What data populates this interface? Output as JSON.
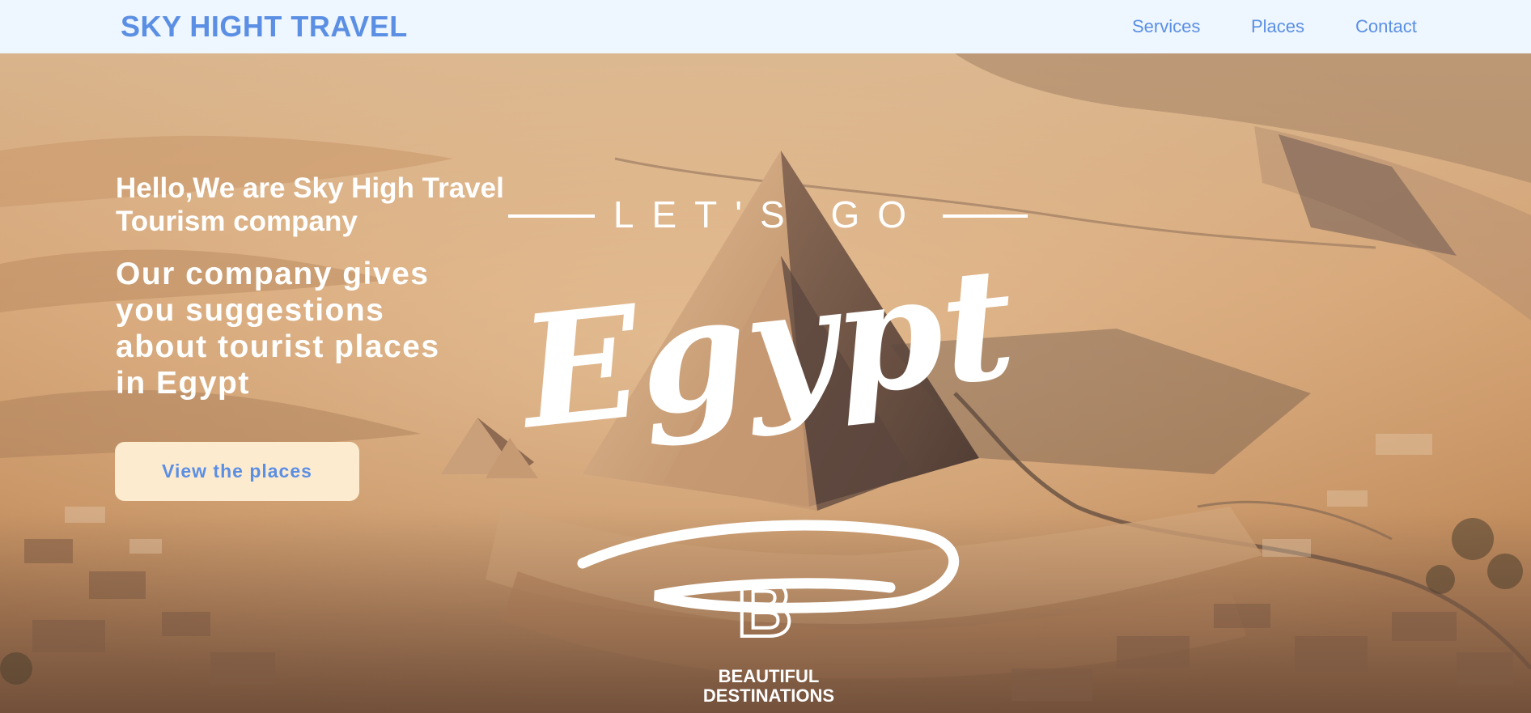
{
  "header": {
    "brand": "SKY HIGHT TRAVEL",
    "nav": [
      {
        "label": "Services"
      },
      {
        "label": "Places"
      },
      {
        "label": "Contact"
      }
    ]
  },
  "hero": {
    "greeting": "Hello,We are Sky High Travel Tourism company",
    "description": "Our company gives you suggestions about tourist places in Egypt",
    "cta_label": "View the places",
    "image": {
      "overlay_small": "LET'S GO",
      "overlay_main": "Egypt",
      "logo_mark": "B",
      "logo_line1": "BEAUTIFUL",
      "logo_line2": "DESTINATIONS"
    }
  },
  "colors": {
    "accent": "#5b8fe3",
    "nav_bg": "#eef6ff",
    "button_bg": "#fdebd0",
    "hero_text": "#ffffff",
    "sand": "#d9a878"
  },
  "icons": {
    "pyramid": "pyramid-graphic",
    "swoosh": "brush-swoosh-graphic",
    "logo": "beautiful-destinations-logo"
  }
}
